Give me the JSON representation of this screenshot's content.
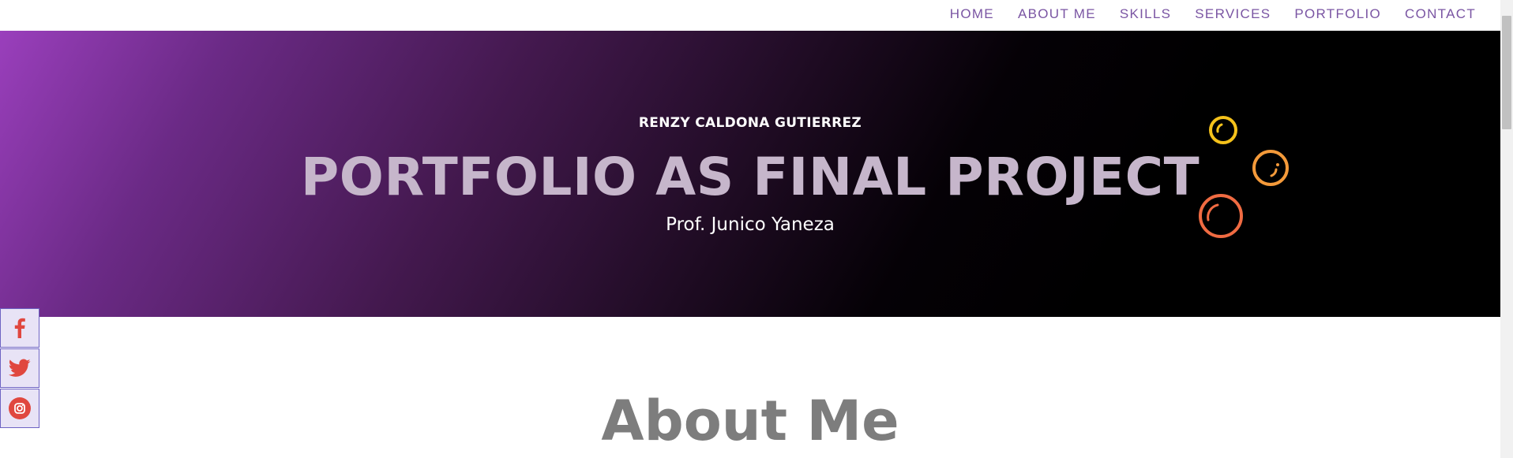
{
  "nav": {
    "links": [
      "HOME",
      "ABOUT ME",
      "SKILLS",
      "SERVICES",
      "PORTFOLIO",
      "CONTACT"
    ],
    "color": "#7a55a3"
  },
  "hero": {
    "kicker": "RENZY CALDONA GUTIERREZ",
    "title": "PORTFOLIO AS FINAL PROJECT",
    "subtitle": "Prof. Junico Yaneza",
    "gradient": [
      "#9a3fbc",
      "#000000"
    ],
    "bubble_colors": [
      "#f5c21b",
      "#f49a3a",
      "#f06b42"
    ]
  },
  "social": {
    "icons": [
      "facebook-icon",
      "twitter-icon",
      "instagram-icon"
    ],
    "icon_color": "#e0473f"
  },
  "about": {
    "heading": "About Me"
  }
}
